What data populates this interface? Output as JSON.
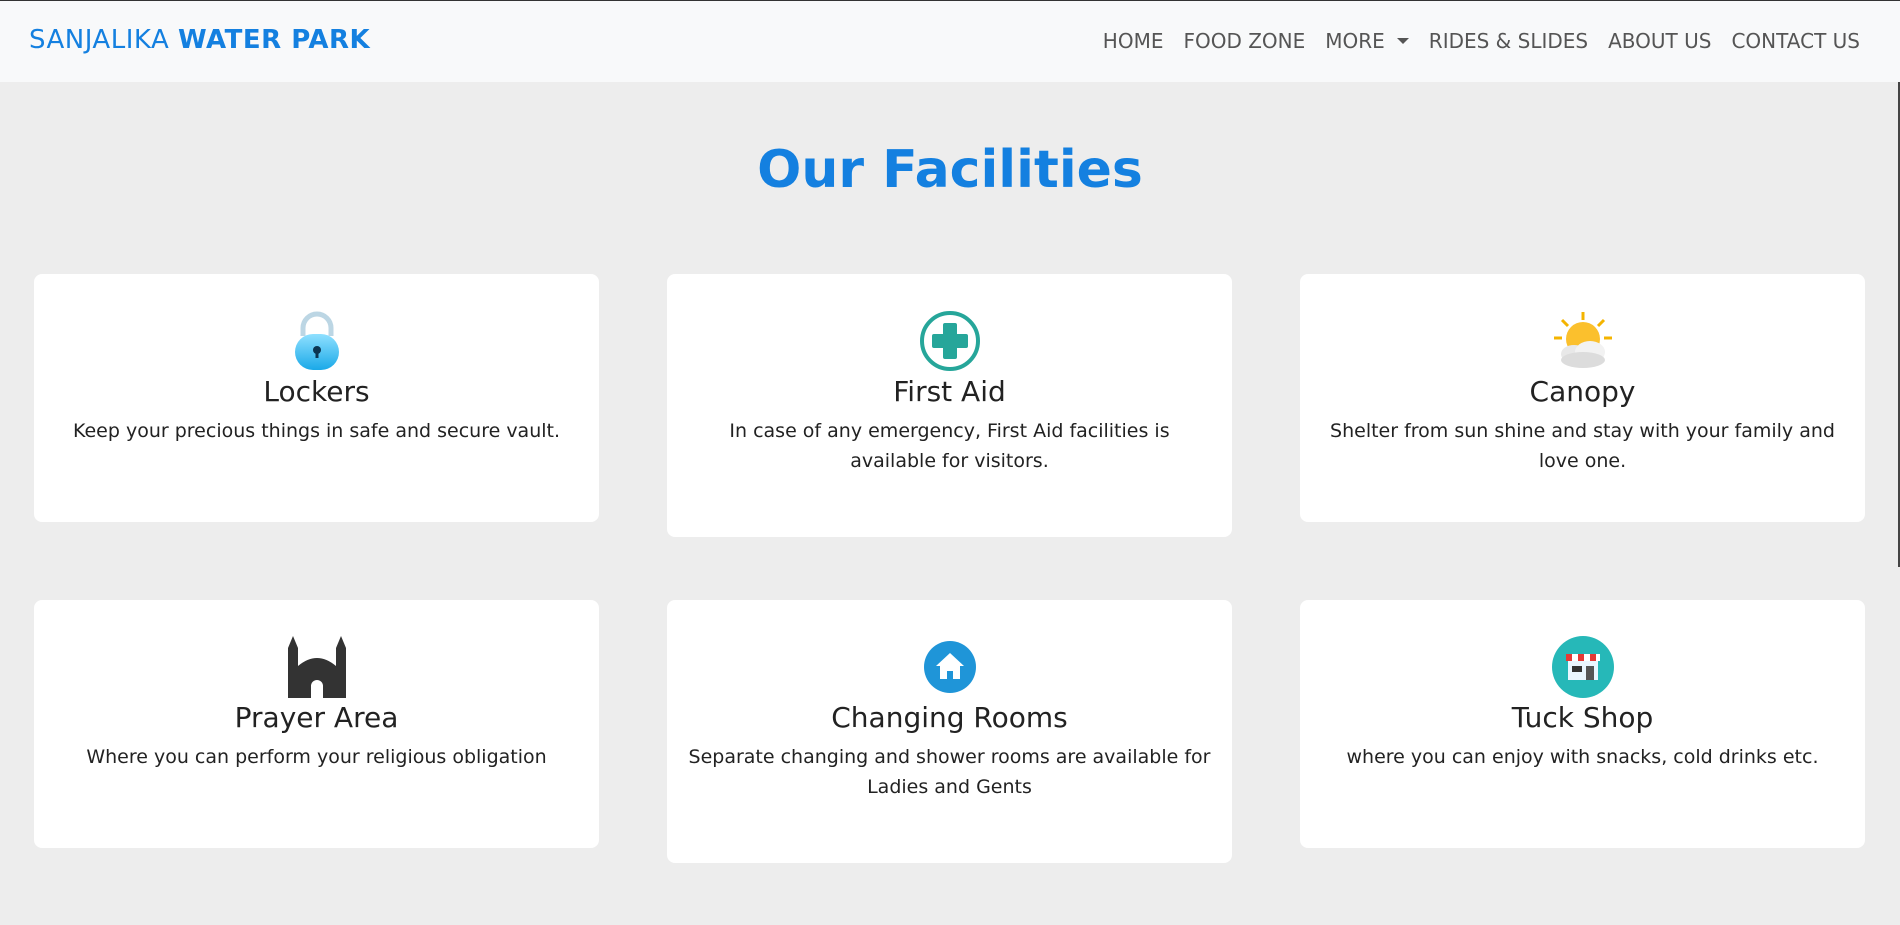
{
  "brand": {
    "part1": "SANJALIKA",
    "part2": "WATER PARK"
  },
  "nav": {
    "home": "HOME",
    "food_zone": "FOOD ZONE",
    "more": "MORE",
    "rides": "RIDES & SLIDES",
    "about": "ABOUT US",
    "contact": "CONTACT US"
  },
  "page": {
    "heading": "Our Facilities"
  },
  "facilities": [
    {
      "icon": "lock-icon",
      "title": "Lockers",
      "text": "Keep your precious things in safe and secure vault."
    },
    {
      "icon": "first-aid-icon",
      "title": "First Aid",
      "text": "In case of any emergency, First Aid facilities is available for visitors."
    },
    {
      "icon": "sun-cloud-icon",
      "title": "Canopy",
      "text": "Shelter from sun shine and stay with your family and love one."
    },
    {
      "icon": "mosque-icon",
      "title": "Prayer Area",
      "text": "Where you can perform your religious obligation"
    },
    {
      "icon": "house-icon",
      "title": "Changing Rooms",
      "text": "Separate changing and shower rooms are available for Ladies and Gents"
    },
    {
      "icon": "shop-icon",
      "title": "Tuck Shop",
      "text": "where you can enjoy with snacks, cold drinks etc."
    }
  ],
  "colors": {
    "brand": "#1480e0",
    "background": "#ededed",
    "card": "#ffffff"
  }
}
